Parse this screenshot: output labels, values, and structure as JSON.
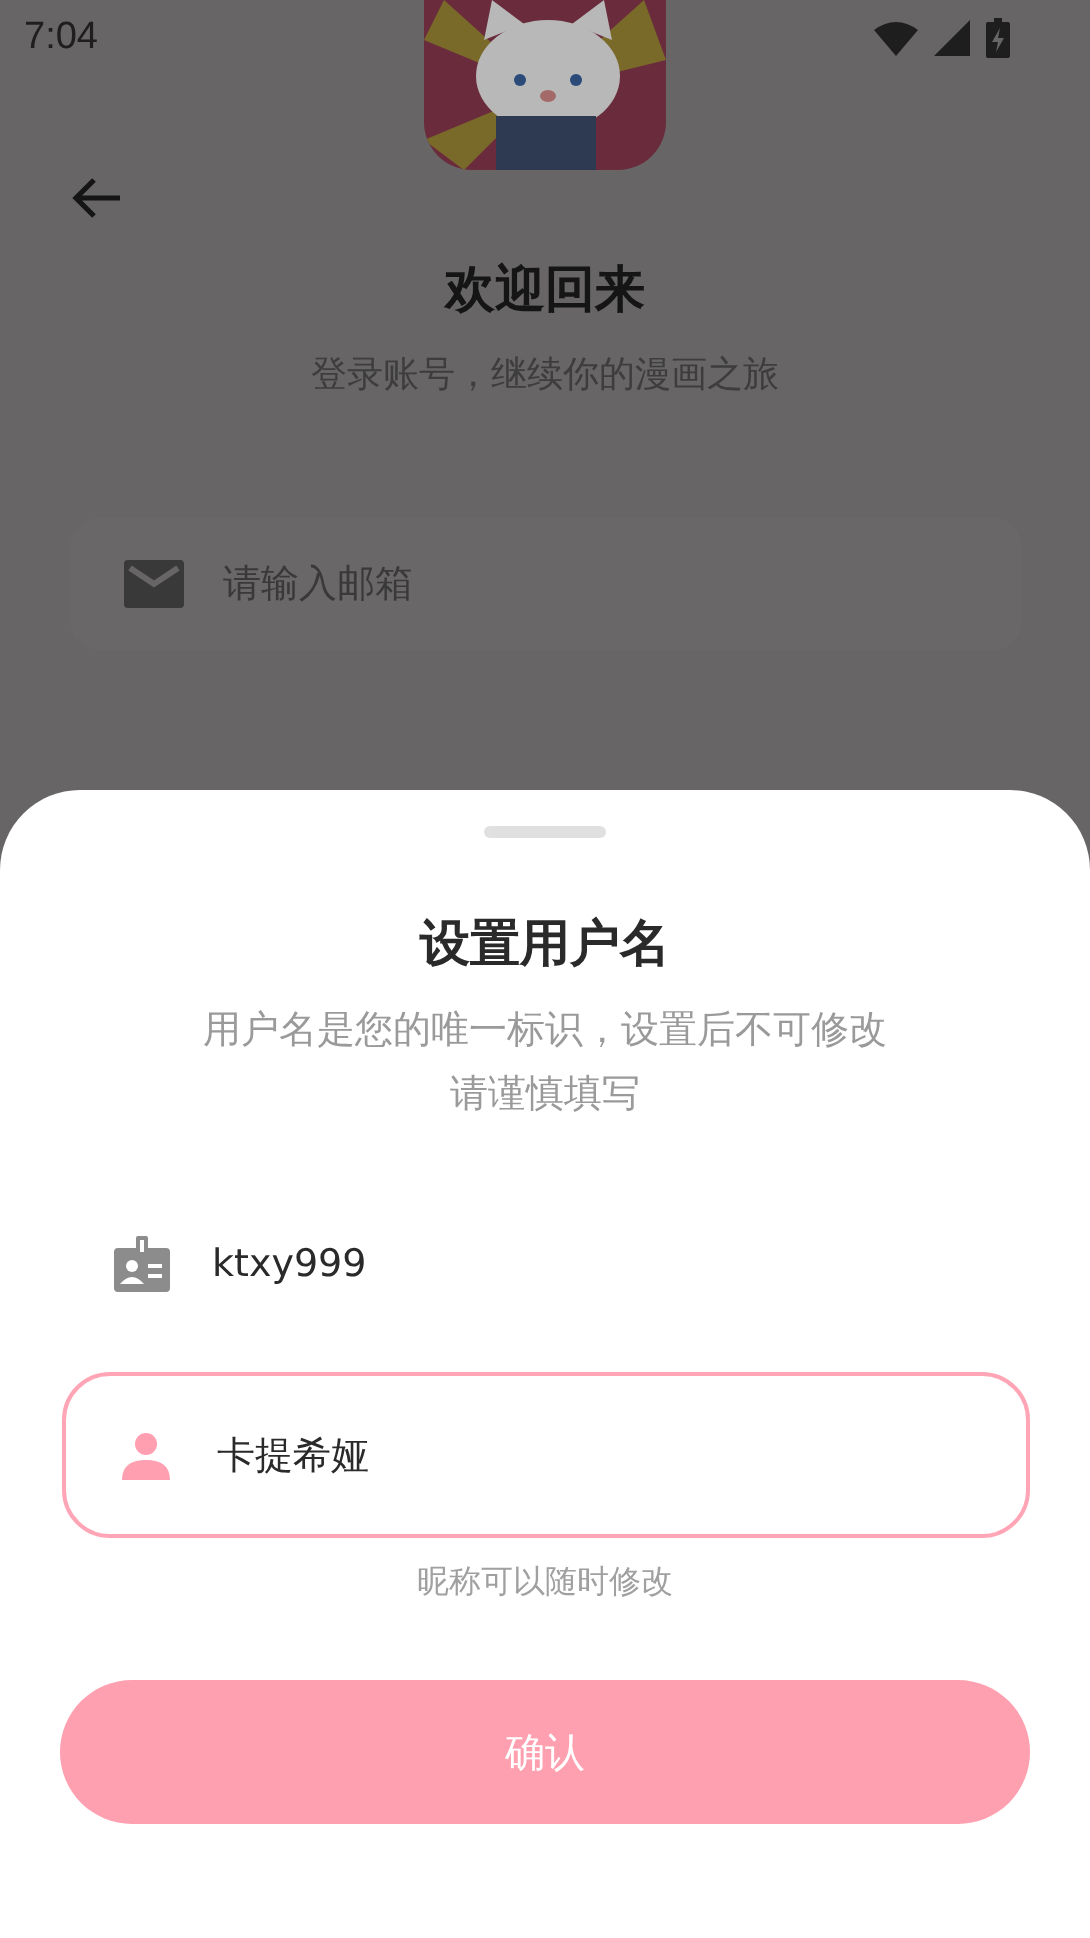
{
  "status_bar": {
    "time": "7:04"
  },
  "background": {
    "title": "欢迎回来",
    "subtitle": "登录账号，继续你的漫画之旅",
    "email_field": {
      "placeholder": "请输入邮箱"
    }
  },
  "sheet": {
    "title": "设置用户名",
    "description": [
      "用户名是您的唯一标识，设置后不可修改",
      "请谨慎填写"
    ],
    "username": {
      "value": "ktxy999"
    },
    "nickname_field": {
      "value": "卡提希娅",
      "focused": true
    },
    "hint": "昵称可以随时修改",
    "confirm_button": "确认"
  }
}
